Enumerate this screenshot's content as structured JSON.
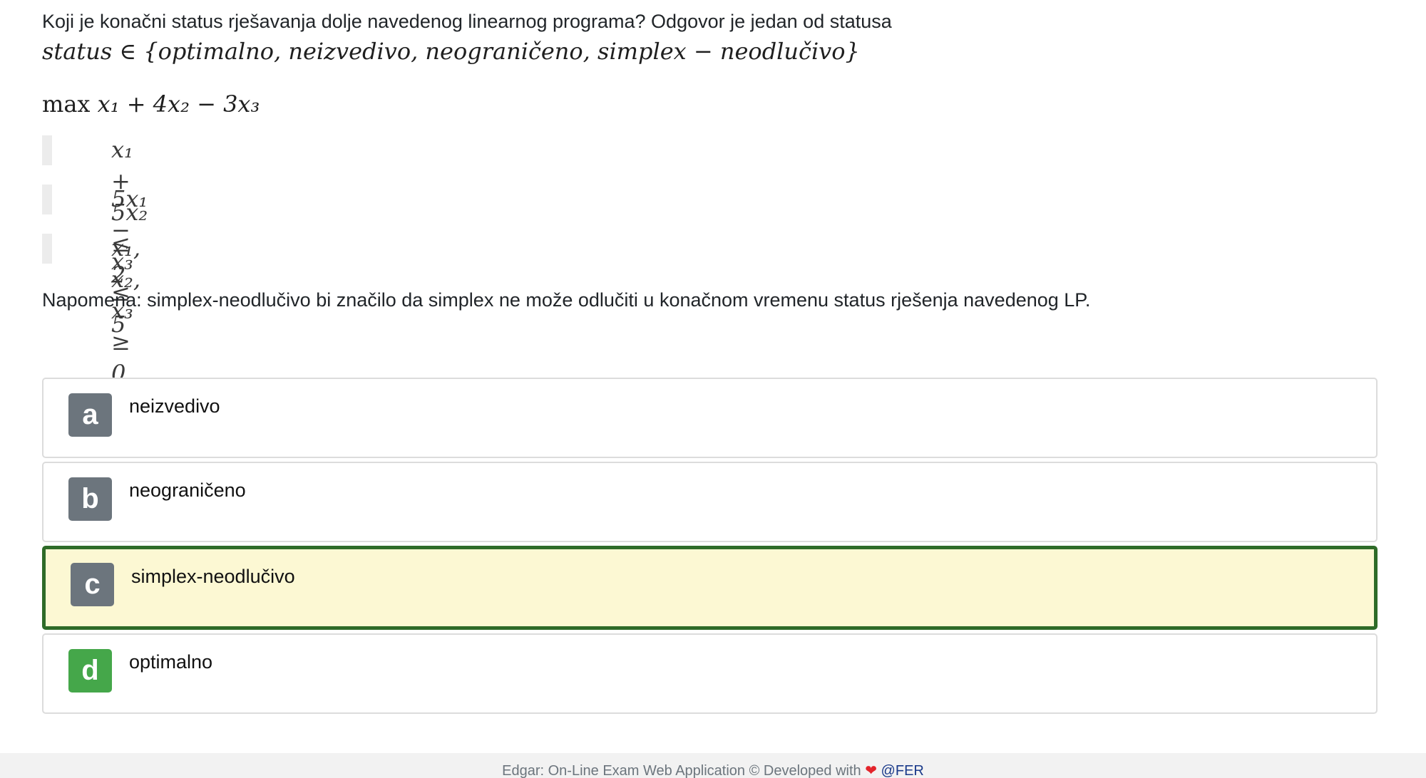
{
  "question": {
    "text": "Koji je konačni status rješavanja dolje navedenog linearnog programa? Odgovor je jedan od statusa",
    "status_set": "status ∈ {optimalno, neizvedivo, neograničeno, simplex − neodlučivo}",
    "objective_prefix": "max",
    "objective_expr": "x₁ + 4x₂ − 3x₃",
    "constraints": [
      "x₁ + 5x₂ ≤ 2",
      "5x₁ − x₃ ≤ 5",
      "x₁, x₂, x₃ ≥ 0"
    ],
    "note": "Napomena: simplex-neodlučivo bi značilo da simplex ne može odlučiti u konačnom vremenu status rješenja navedenog LP."
  },
  "answers": [
    {
      "letter": "a",
      "label": "neizvedivo"
    },
    {
      "letter": "b",
      "label": "neograničeno"
    },
    {
      "letter": "c",
      "label": "simplex-neodlučivo"
    },
    {
      "letter": "d",
      "label": "optimalno"
    }
  ],
  "footer": {
    "text": "Edgar: On-Line Exam Web Application © Developed with",
    "heart": "❤",
    "link": "@FER"
  },
  "colors": {
    "selected_border": "#2e6b28",
    "selected_background": "#fcf8d3",
    "letter_default": "#6c757d",
    "letter_correct": "#45a74a"
  }
}
